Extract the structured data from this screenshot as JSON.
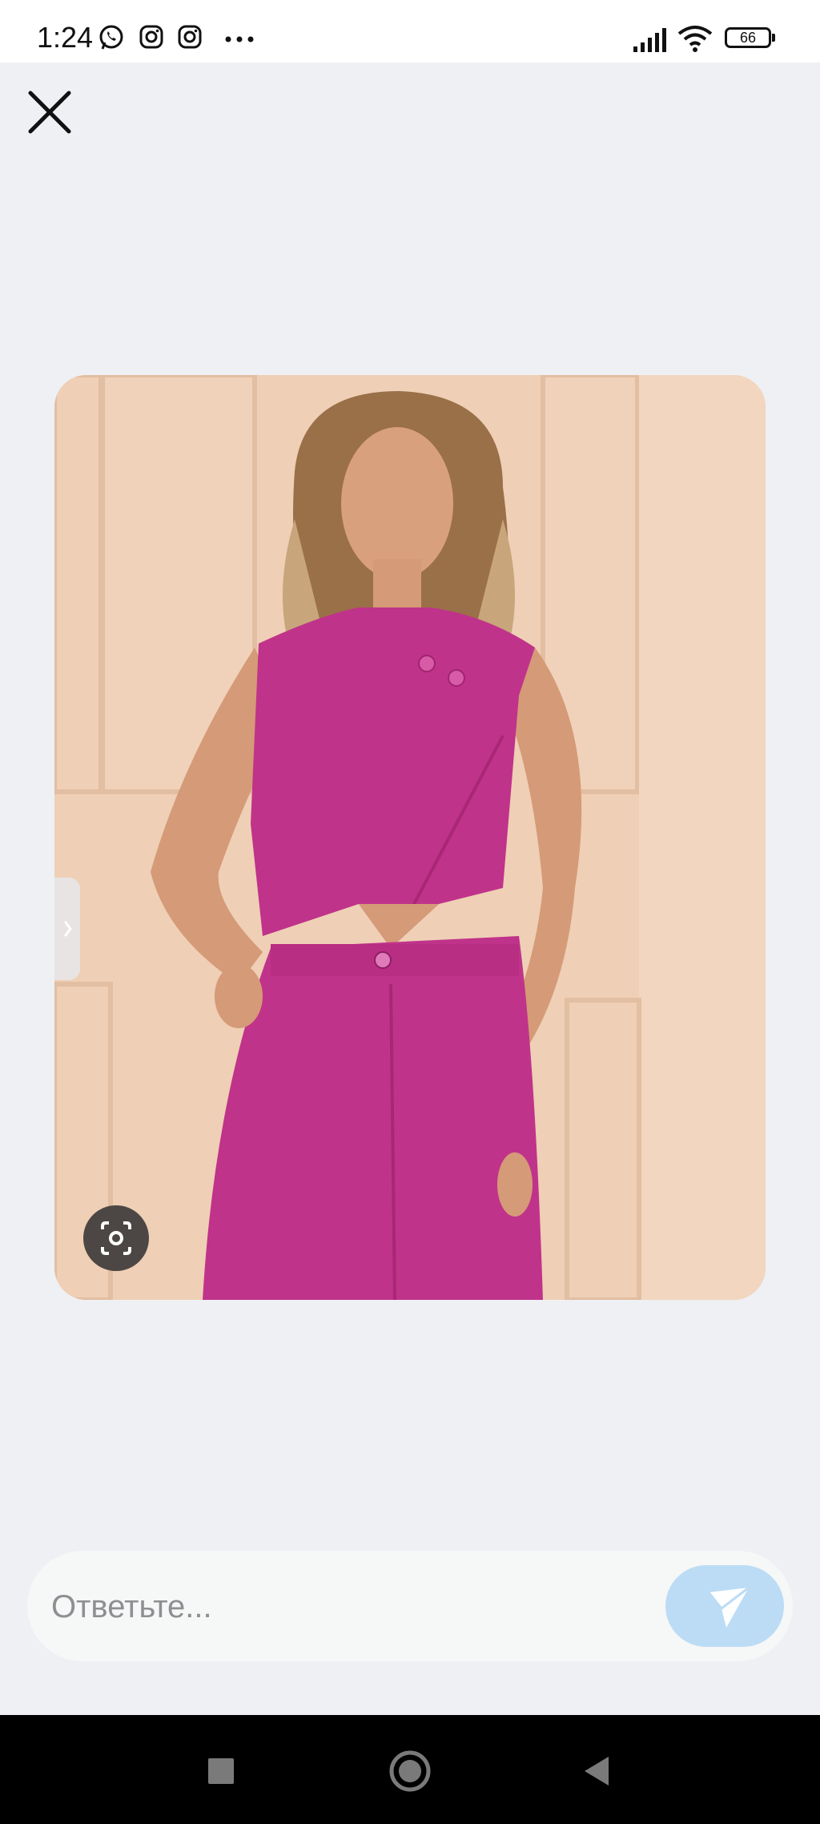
{
  "status_bar": {
    "time": "1:24",
    "notification_icons": [
      "whatsapp-icon",
      "instagram-icon",
      "instagram-icon",
      "more-dots-icon"
    ],
    "system_icons": [
      "signal-icon",
      "wifi-icon"
    ],
    "battery_level": "66"
  },
  "viewer": {
    "close_icon": "close-icon",
    "photo_description_icon": "lens-icon",
    "next_icon": "chevron-right-icon"
  },
  "reply": {
    "placeholder": "Ответьте...",
    "value": "",
    "send_icon": "send-icon"
  },
  "navigation": {
    "buttons": [
      "recents-square-icon",
      "home-circle-icon",
      "back-triangle-icon"
    ]
  },
  "colors": {
    "accent_send": "#bcdcf5",
    "outfit": "#c0338a",
    "background": "#eef0f4"
  }
}
